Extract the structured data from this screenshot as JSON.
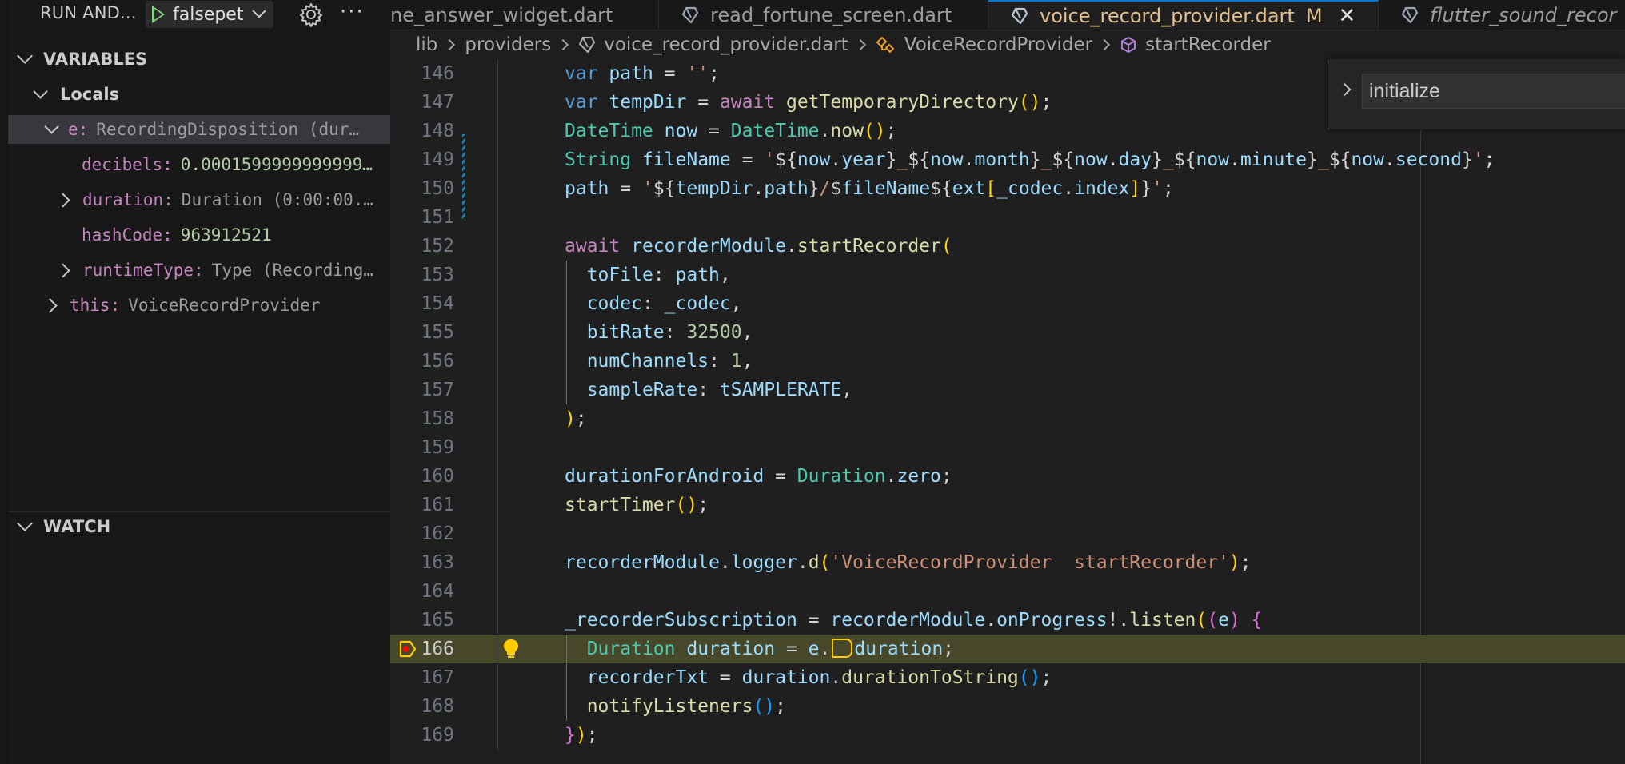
{
  "sidebar": {
    "title": "RUN AND...",
    "launch_config": "falsepet",
    "sections": {
      "variables": "VARIABLES",
      "watch": "WATCH"
    },
    "locals_label": "Locals",
    "variables": {
      "e": {
        "name": "e:",
        "value": "RecordingDisposition (dur…"
      },
      "decibels": {
        "name": "decibels:",
        "value": "0.0001599999999999…"
      },
      "duration": {
        "name": "duration:",
        "value": "Duration (0:00:00.…"
      },
      "hashcode": {
        "name": "hashCode:",
        "value": "963912521"
      },
      "runtimetype": {
        "name": "runtimeType:",
        "value": "Type (Recording…"
      },
      "this": {
        "name": "this:",
        "value": "VoiceRecordProvider"
      }
    }
  },
  "tabs": [
    {
      "label": "ne_answer_widget.dart"
    },
    {
      "label": "read_fortune_screen.dart"
    },
    {
      "label": "voice_record_provider.dart",
      "modified": "M",
      "close": "✕"
    },
    {
      "label": "flutter_sound_recor"
    }
  ],
  "breadcrumb": {
    "lib": "lib",
    "providers": "providers",
    "file": "voice_record_provider.dart",
    "class": "VoiceRecordProvider",
    "method": "startRecorder"
  },
  "find": {
    "value": "initialize"
  },
  "editor": {
    "current_line": 166,
    "line_numbers": [
      "146",
      "147",
      "148",
      "149",
      "150",
      "151",
      "152",
      "153",
      "154",
      "155",
      "156",
      "157",
      "158",
      "159",
      "160",
      "161",
      "162",
      "163",
      "164",
      "165",
      "166",
      "167",
      "168",
      "169"
    ]
  },
  "colors": {
    "accent": "#0078d4",
    "current_line_bg": "#47472a",
    "modified_tab": "#e2c08d",
    "breakpoint": "#e51400"
  }
}
